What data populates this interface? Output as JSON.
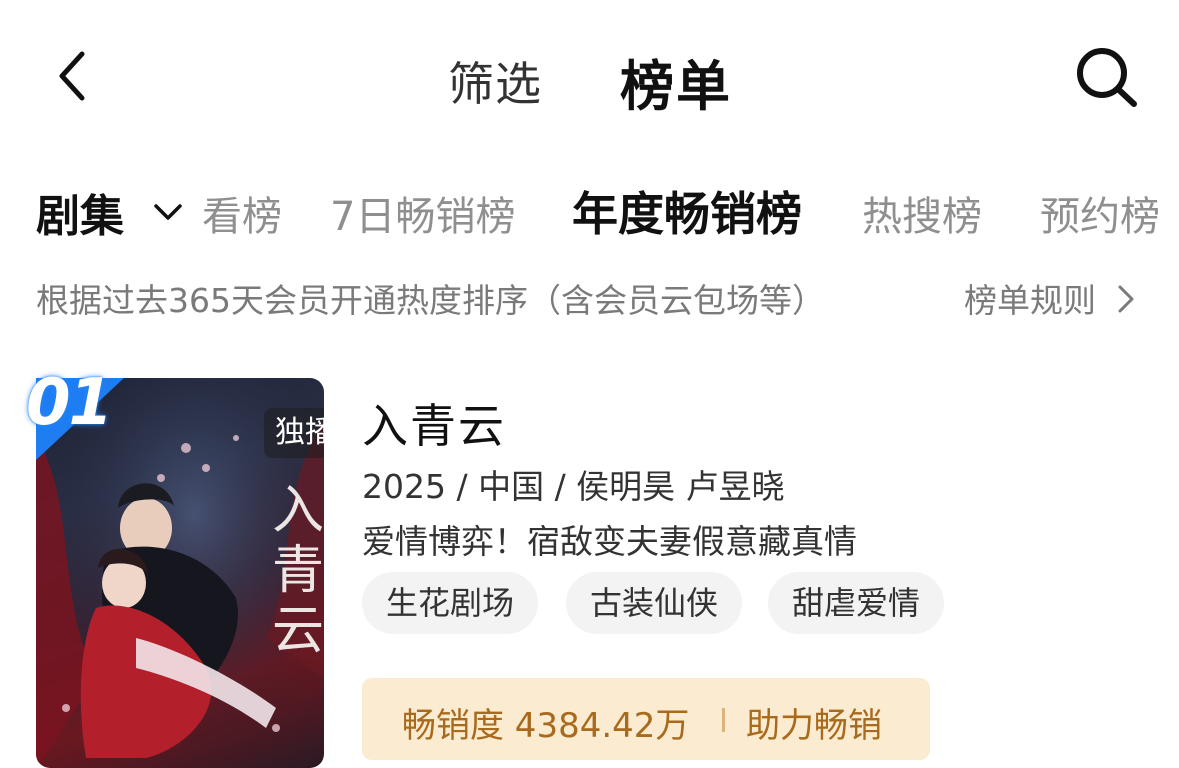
{
  "header": {
    "filter_label": "筛选",
    "ranking_label": "榜单"
  },
  "tabs": {
    "category": "剧集",
    "items": [
      {
        "label": "看榜",
        "active": false
      },
      {
        "label": "7日畅销榜",
        "active": false
      },
      {
        "label": "年度畅销榜",
        "active": true
      },
      {
        "label": "热搜榜",
        "active": false
      },
      {
        "label": "预约榜",
        "active": false
      }
    ]
  },
  "description": {
    "text": "根据过去365天会员开通热度排序（含会员云包场等）",
    "rules_label": "榜单规则"
  },
  "items": [
    {
      "rank": "01",
      "exclusive_tag": "独播",
      "title": "入青云",
      "meta": "2025 / 中国 / 侯明昊 卢昱晓",
      "tagline": "爱情博弈！宿敌变夫妻假意藏真情",
      "tags": [
        "生花剧场",
        "古装仙侠",
        "甜虐爱情"
      ],
      "sales_text": "畅销度 4384.42万",
      "boost_label": "助力畅销"
    }
  ],
  "colors": {
    "sales_bg": "#fbebd0",
    "sales_text": "#a86a1c",
    "rank_badge": "#1f7df2",
    "inactive_tab": "#8f8f8f"
  },
  "icons": {
    "back": "chevron-left-icon",
    "search": "search-icon",
    "category_dropdown": "chevron-down-icon",
    "rules_arrow": "chevron-right-icon"
  }
}
